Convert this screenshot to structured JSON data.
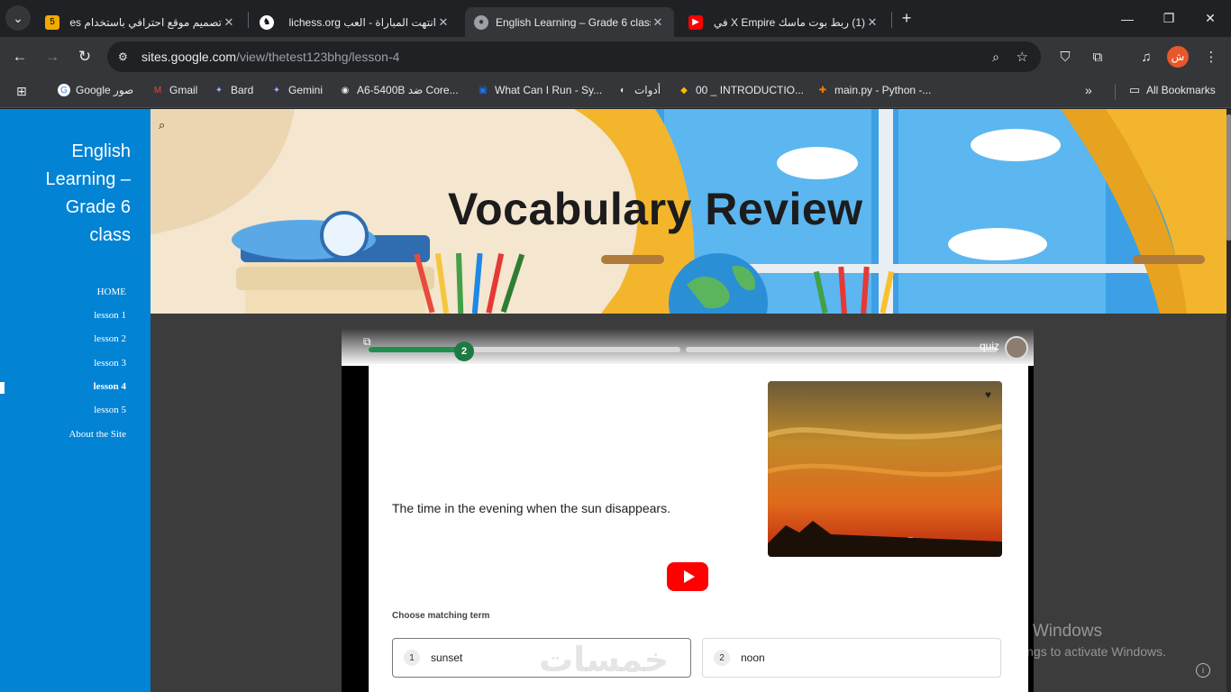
{
  "browser": {
    "tabs": [
      {
        "title": "تصميم موقع احترافي باستخدام es",
        "favicon_text": "5",
        "favicon_color": "#f2a900"
      },
      {
        "title": "انتهت المباراة - العب lichess.org",
        "favicon_text": "♞",
        "favicon_color": "#ffffff"
      },
      {
        "title": "English Learning – Grade 6 class",
        "favicon_text": "●",
        "favicon_color": "#9aa0a6",
        "active": true
      },
      {
        "title": "(1) ربط بوت ماسك X Empire في",
        "favicon_text": "▶",
        "favicon_color": "#ff0000"
      }
    ],
    "new_tab": "+",
    "url_host": "sites.google.com",
    "url_path": "/view/thetest123bhg/lesson-4",
    "bookmarks": [
      {
        "label": "Google صور",
        "icon": "G",
        "color": "#4285f4"
      },
      {
        "label": "Gmail",
        "icon": "M",
        "color": "#ea4335"
      },
      {
        "label": "Bard",
        "icon": "✦",
        "color": "#8ab4f8"
      },
      {
        "label": "Gemini",
        "icon": "✦",
        "color": "#8ab4f8"
      },
      {
        "label": "A6-5400B ضد Core...",
        "icon": "◉",
        "color": "#e8eaed"
      },
      {
        "label": "What Can I Run - Sy...",
        "icon": "▣",
        "color": "#1a73e8"
      },
      {
        "label": "أدوات",
        "icon": "◐",
        "color": "#e8eaed"
      },
      {
        "label": "00 _ INTRODUCTIO...",
        "icon": "◆",
        "color": "#fbbc04"
      },
      {
        "label": "main.py - Python -...",
        "icon": "✚",
        "color": "#ff7a00"
      }
    ],
    "all_bookmarks": "All Bookmarks",
    "profile_initial": "ش"
  },
  "site": {
    "title_lines": [
      "English",
      "Learning –",
      "Grade 6",
      "class"
    ],
    "nav": [
      {
        "label": "HOME",
        "bold": false
      },
      {
        "label": "lesson 1",
        "bold": false
      },
      {
        "label": "lesson 2",
        "bold": false
      },
      {
        "label": "lesson 3",
        "bold": false
      },
      {
        "label": "lesson 4",
        "bold": true
      },
      {
        "label": "lesson 5",
        "bold": false
      },
      {
        "label": "About the Site",
        "bold": false
      }
    ],
    "banner_title": "Vocabulary Review"
  },
  "quiz": {
    "label": "quiz",
    "step": "2",
    "progress": 0.3,
    "question": "The time in the evening when the sun disappears.",
    "choose_label": "Choose matching term",
    "options": [
      {
        "num": "1",
        "label": "sunset"
      },
      {
        "num": "2",
        "label": "noon"
      }
    ]
  },
  "overlay": {
    "activate_title": "Activate Windows",
    "activate_sub": "Go to Settings to activate Windows.",
    "watermark": "خمسات"
  }
}
